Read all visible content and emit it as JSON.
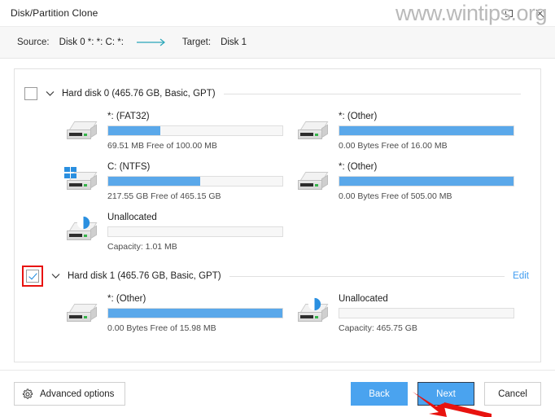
{
  "window": {
    "title": "Disk/Partition Clone",
    "maximize_icon": "maximize-icon",
    "close_icon": "close-icon"
  },
  "watermark": {
    "text": "www.wintips.org"
  },
  "sourcebar": {
    "source_label": "Source:",
    "source_value": "Disk 0 *: *: C: *:",
    "arrow_icon": "arrow-right-icon",
    "arrow_color": "#2aa6b8",
    "target_label": "Target:",
    "target_value": "Disk 1"
  },
  "disks": [
    {
      "checked": false,
      "highlighted": false,
      "title": "Hard disk 0 (465.76 GB, Basic, GPT)",
      "edit_label": "",
      "partitions": [
        {
          "icon": "hard-drive-icon",
          "name": "*: (FAT32)",
          "sub": "69.51 MB Free of 100.00 MB",
          "fill_percent": 30
        },
        {
          "icon": "hard-drive-icon",
          "name": "*: (Other)",
          "sub": "0.00 Bytes Free of 16.00 MB",
          "fill_percent": 100
        },
        {
          "icon": "hard-drive-windows-icon",
          "name": "C: (NTFS)",
          "sub": "217.55 GB Free of 465.15 GB",
          "fill_percent": 53
        },
        {
          "icon": "hard-drive-icon",
          "name": "*: (Other)",
          "sub": "0.00 Bytes Free of 505.00 MB",
          "fill_percent": 100
        },
        {
          "icon": "hard-drive-unallocated-icon",
          "name": "Unallocated",
          "sub": "Capacity: 1.01 MB",
          "fill_percent": 0
        }
      ]
    },
    {
      "checked": true,
      "highlighted": true,
      "title": "Hard disk 1 (465.76 GB, Basic, GPT)",
      "edit_label": "Edit",
      "partitions": [
        {
          "icon": "hard-drive-icon",
          "name": "*: (Other)",
          "sub": "0.00 Bytes Free of 15.98 MB",
          "fill_percent": 100
        },
        {
          "icon": "hard-drive-unallocated-icon",
          "name": "Unallocated",
          "sub": "Capacity: 465.75 GB",
          "fill_percent": 0
        }
      ]
    }
  ],
  "footer": {
    "advanced_icon": "gear-icon",
    "advanced_label": "Advanced options",
    "back_label": "Back",
    "next_label": "Next",
    "cancel_label": "Cancel"
  },
  "colors": {
    "accent": "#4aa3ef",
    "bar_fill": "#5aa8ea",
    "link": "#3d9bf0",
    "annotation_red": "#e8130f",
    "arrow_teal": "#2aa6b8"
  }
}
